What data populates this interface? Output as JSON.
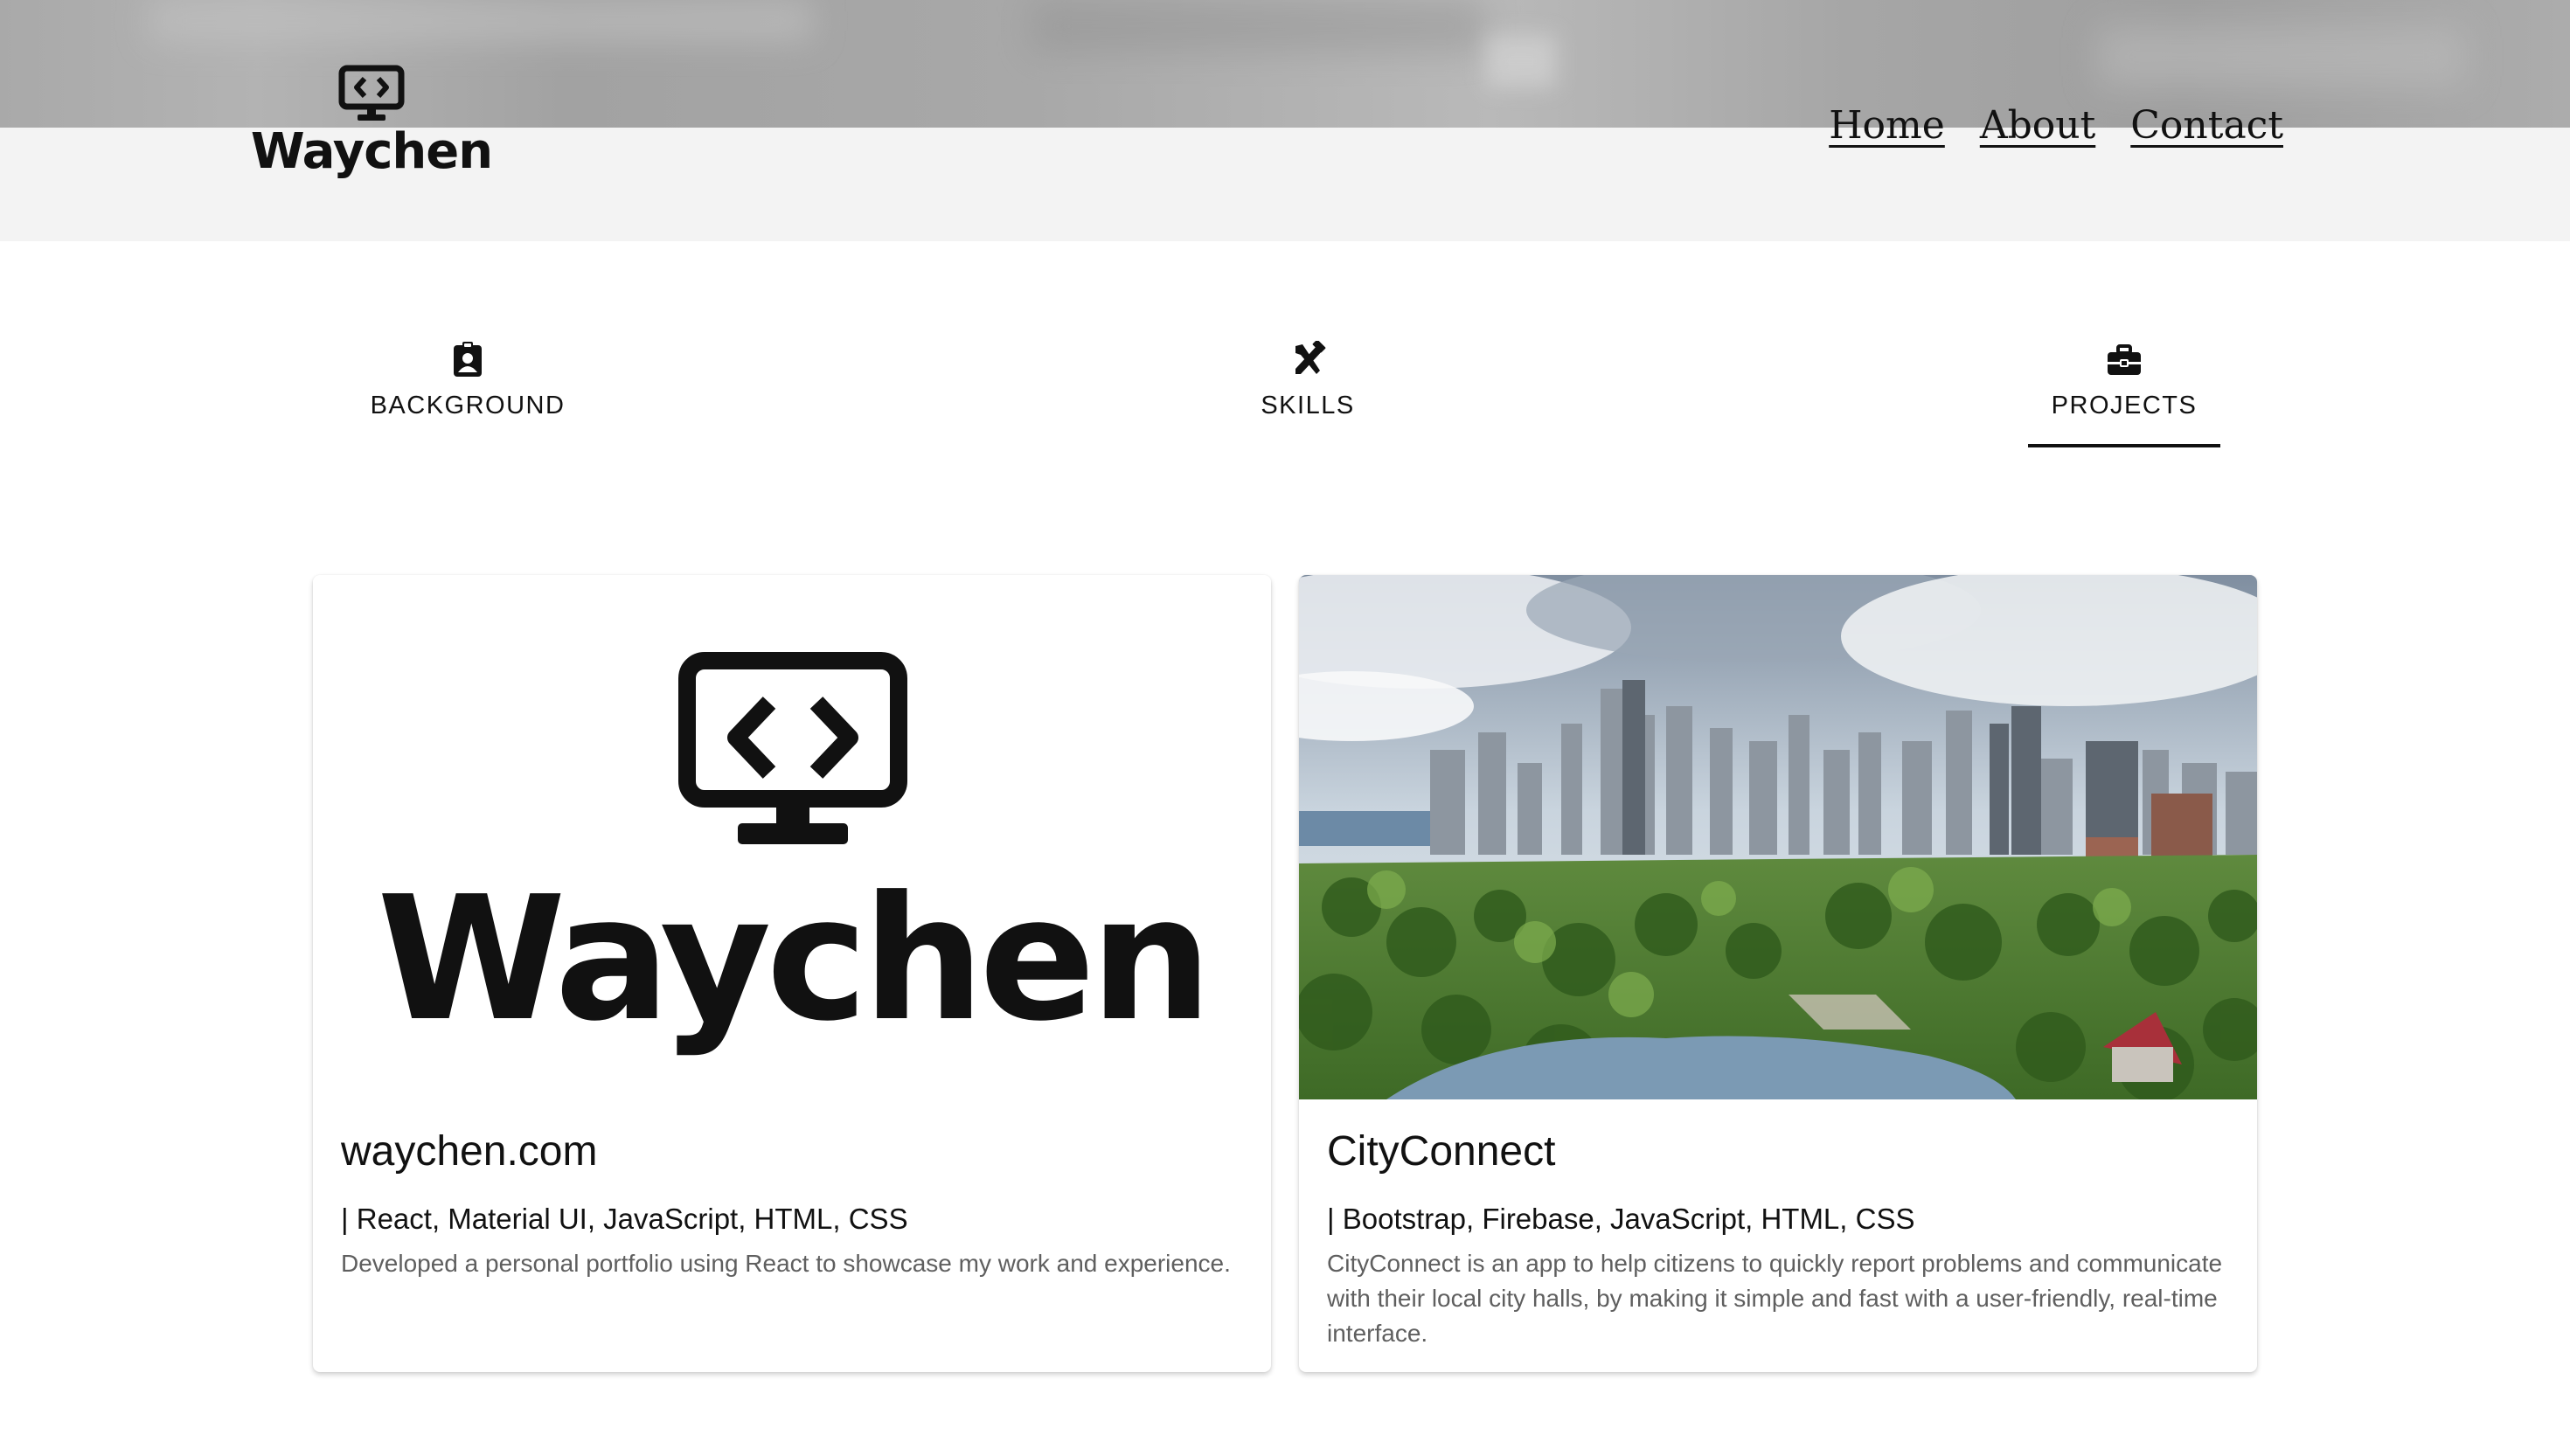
{
  "header": {
    "logo_text": "Waychen",
    "nav": [
      "Home",
      "About",
      "Contact"
    ]
  },
  "tabs": [
    {
      "label": "BACKGROUND",
      "icon": "badge-icon",
      "active": false
    },
    {
      "label": "SKILLS",
      "icon": "tools-icon",
      "active": false
    },
    {
      "label": "PROJECTS",
      "icon": "briefcase-icon",
      "active": true
    }
  ],
  "projects": [
    {
      "title": "waychen.com",
      "tech": "| React, Material UI, JavaScript, HTML, CSS",
      "description": "Developed a personal portfolio using React to showcase my work and experience.",
      "image": "waychen-logo",
      "image_text": "Waychen"
    },
    {
      "title": "CityConnect",
      "tech": "| Bootstrap, Firebase, JavaScript, HTML, CSS",
      "description": "CityConnect is an app to help citizens to quickly report problems and communicate with their local city halls, by making it simple and fast with a user-friendly, real-time interface.",
      "image": "city-skyline-photo"
    }
  ]
}
